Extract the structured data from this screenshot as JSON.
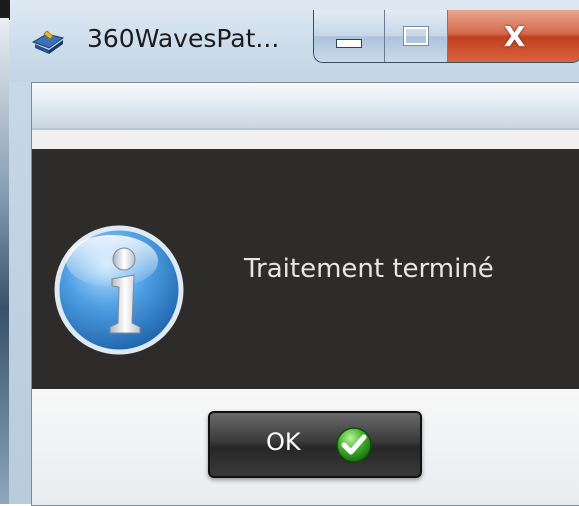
{
  "window": {
    "title": "360WavesPat...",
    "app_icon": "app-icon",
    "controls": {
      "minimize_icon": "minimize-icon",
      "maximize_icon": "maximize-icon",
      "close_label": "X"
    }
  },
  "dialog": {
    "icon": "info-icon",
    "message": "Traitement terminé",
    "ok_label": "OK",
    "ok_icon": "checkmark-icon"
  },
  "colors": {
    "message_background": "#2d2c2a",
    "close_button": "#c1401e",
    "check_green": "#3fae2a"
  }
}
